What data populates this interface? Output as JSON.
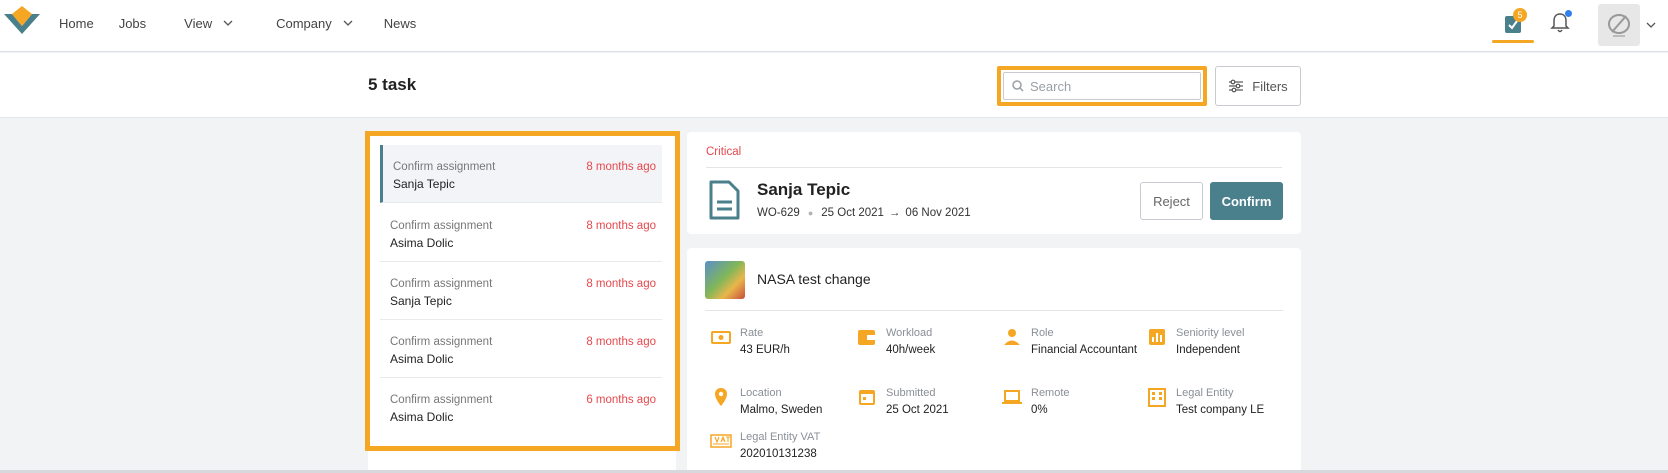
{
  "nav": {
    "items": [
      {
        "label": "Home"
      },
      {
        "label": "Jobs"
      },
      {
        "label": "View"
      },
      {
        "label": "Company"
      },
      {
        "label": "News"
      }
    ],
    "tasks_badge": "5"
  },
  "header": {
    "task_count": "5 task",
    "search_placeholder": "Search",
    "filters_label": "Filters"
  },
  "tasks": [
    {
      "type": "Confirm assignment",
      "name": "Sanja Tepic",
      "time": "8 months ago",
      "active": true
    },
    {
      "type": "Confirm assignment",
      "name": "Asima Dolic",
      "time": "8 months ago"
    },
    {
      "type": "Confirm assignment",
      "name": "Sanja Tepic",
      "time": "8 months ago"
    },
    {
      "type": "Confirm assignment",
      "name": "Asima Dolic",
      "time": "8 months ago"
    },
    {
      "type": "Confirm assignment",
      "name": "Asima Dolic",
      "time": "6 months ago"
    }
  ],
  "detail": {
    "priority": "Critical",
    "name": "Sanja Tepic",
    "work_order": "WO-629",
    "start_date": "25 Oct 2021",
    "end_date": "06 Nov 2021",
    "reject_label": "Reject",
    "confirm_label": "Confirm",
    "job_title": "NASA test change",
    "fields": {
      "rate": {
        "label": "Rate",
        "value": "43 EUR/h"
      },
      "workload": {
        "label": "Workload",
        "value": "40h/week"
      },
      "role": {
        "label": "Role",
        "value": "Financial Accountant"
      },
      "seniority": {
        "label": "Seniority level",
        "value": "Independent"
      },
      "location": {
        "label": "Location",
        "value": "Malmo, Sweden"
      },
      "submitted": {
        "label": "Submitted",
        "value": "25 Oct 2021"
      },
      "remote": {
        "label": "Remote",
        "value": "0%"
      },
      "legal_entity": {
        "label": "Legal Entity",
        "value": "Test company LE"
      },
      "legal_entity_vat": {
        "label": "Legal Entity VAT",
        "value": "202010131238"
      }
    }
  },
  "colors": {
    "accent": "#f5a623",
    "primary": "#4a7f8c",
    "danger": "#e5484d"
  }
}
